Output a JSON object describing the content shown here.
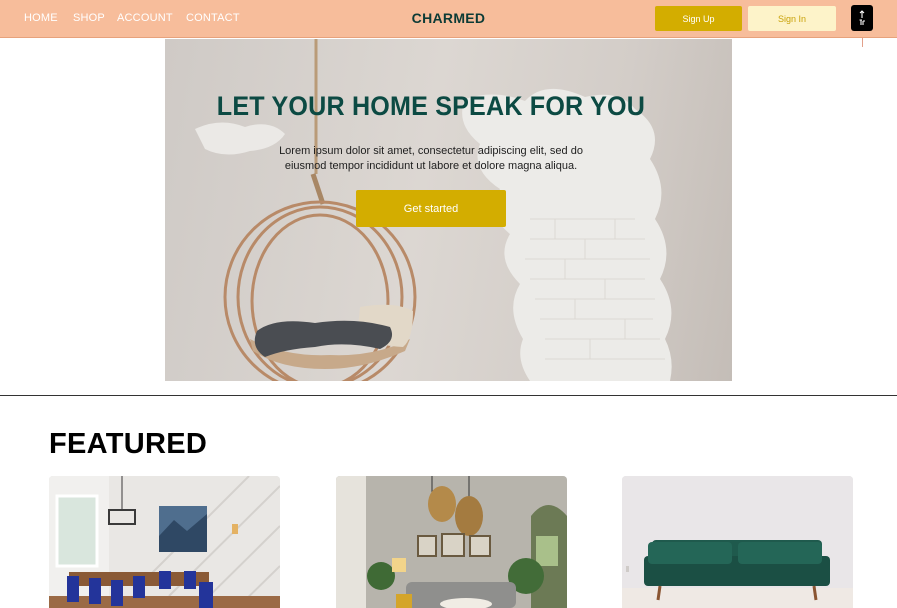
{
  "nav": {
    "links": [
      "HOME",
      "SHOP",
      "ACCOUNT",
      "CONTACT"
    ],
    "brand": "CHARMED",
    "signup_label": "Sign Up",
    "signin_label": "Sign In",
    "scroll_top_icon": "arrow-up-icon"
  },
  "hero": {
    "title": "LET YOUR HOME SPEAK FOR YOU",
    "subtitle_line1": "Lorem ipsum dolor sit amet, consectetur adipiscing elit, sed do",
    "subtitle_line2": "eiusmod tempor incididunt ut labore et dolore magna aliqua.",
    "cta_label": "Get started",
    "image": "hanging-chair-photo"
  },
  "featured": {
    "title": "FEATURED",
    "cards": [
      {
        "image": "dining-room-photo"
      },
      {
        "image": "living-room-photo"
      },
      {
        "image": "green-sofa-photo"
      }
    ]
  },
  "colors": {
    "nav_bg": "#f7bd9b",
    "accent": "#d3ad00",
    "accent_light": "#fdf3c9",
    "brand": "#0c3b36",
    "hero_title": "#0c4a43"
  }
}
